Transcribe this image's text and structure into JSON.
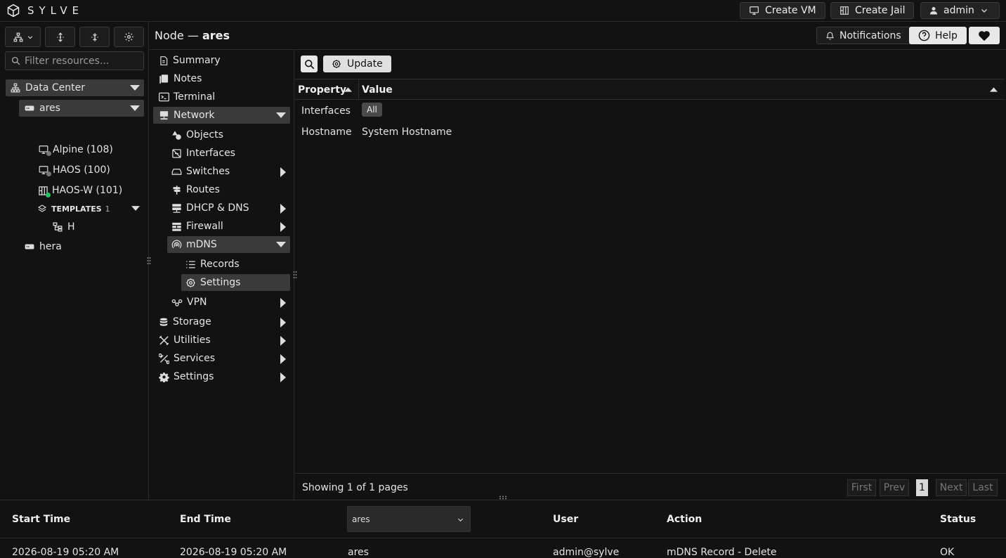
{
  "app": {
    "name": "SYLVE"
  },
  "topbar": {
    "create_vm": "Create VM",
    "create_jail": "Create Jail",
    "user": "admin"
  },
  "sidebar": {
    "filter_placeholder": "Filter resources...",
    "tree": {
      "datacenter": "Data Center",
      "node_ares": "ares",
      "vm_alpine": "Alpine (108)",
      "vm_haos": "HAOS (100)",
      "jail_haosw": "HAOS-W (101)",
      "templates_label": "TEMPLATES",
      "templates_count": "1",
      "template_h": "H",
      "node_hera": "hera"
    }
  },
  "header": {
    "title_prefix": "Node — ",
    "title_node": "ares",
    "notifications": "Notifications",
    "help": "Help"
  },
  "menu": {
    "summary": "Summary",
    "notes": "Notes",
    "terminal": "Terminal",
    "network": "Network",
    "objects": "Objects",
    "interfaces": "Interfaces",
    "switches": "Switches",
    "routes": "Routes",
    "dhcp_dns": "DHCP & DNS",
    "firewall": "Firewall",
    "mdns": "mDNS",
    "records": "Records",
    "settings_sub": "Settings",
    "vpn": "VPN",
    "storage": "Storage",
    "utilities": "Utilities",
    "services": "Services",
    "settings": "Settings"
  },
  "content": {
    "update_label": "Update",
    "columns": {
      "property": "Property",
      "value": "Value"
    },
    "rows": [
      {
        "property": "Interfaces",
        "value": "All"
      },
      {
        "property": "Hostname",
        "value": "System Hostname"
      }
    ],
    "footer": {
      "showing": "Showing 1 of 1 pages",
      "first": "First",
      "prev": "Prev",
      "page": "1",
      "next": "Next",
      "last": "Last"
    }
  },
  "tasks": {
    "columns": {
      "start": "Start Time",
      "end": "End Time",
      "node_select": "ares",
      "user": "User",
      "action": "Action",
      "status": "Status"
    },
    "row": {
      "start": "2026-08-19 05:20 AM",
      "end": "2026-08-19 05:20 AM",
      "node": "ares",
      "user": "admin@sylve",
      "action": "mDNS Record - Delete",
      "status": "OK"
    }
  },
  "colors": {
    "accent_green": "#22c55e",
    "selected_bg": "#3a3a3a",
    "bg": "#121212"
  }
}
